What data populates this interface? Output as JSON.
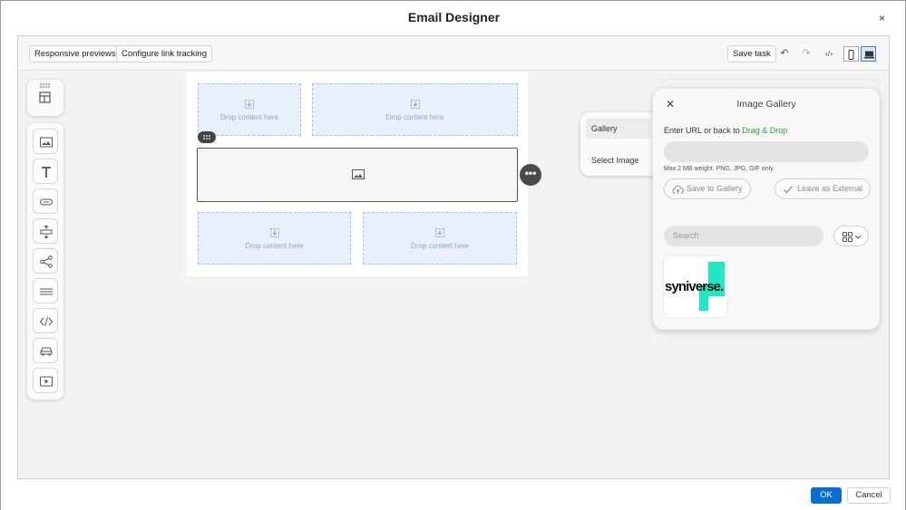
{
  "window": {
    "title": "Email Designer",
    "close_label": "×"
  },
  "toolbar": {
    "responsive_previews": "Responsive previews",
    "configure_link_tracking": "Configure link tracking",
    "save_task": "Save task",
    "undo_icon": "undo-icon",
    "redo_icon": "redo-icon",
    "code_icon": "code-icon",
    "mobile_view_icon": "mobile-icon",
    "desktop_view_icon": "desktop-icon",
    "active_view": "desktop"
  },
  "palette": {
    "items": [
      "grid-icon",
      "image-icon",
      "text-icon",
      "button-icon",
      "spacer-icon",
      "share-icon",
      "divider-icon",
      "html-icon",
      "car-icon",
      "video-icon"
    ]
  },
  "canvas": {
    "drop_label": "Drop content here",
    "drop_cells": [
      {
        "label": "Drop content here"
      },
      {
        "label": "Drop content here"
      },
      {
        "label": "Drop content here"
      },
      {
        "label": "Drop content here"
      }
    ]
  },
  "source_menu": {
    "items": [
      {
        "label": "Gallery",
        "active": true
      },
      {
        "label": "Select Image",
        "active": false
      }
    ]
  },
  "gallery": {
    "title": "Image Gallery",
    "close_label": "✕",
    "instruction": "Enter URL or back to ",
    "instruction_link": "Drag & Drop",
    "url_value": "",
    "note": "Max 2 MB weight. PNG, JPG, GIF only.",
    "save_to_gallery": "Save to Gallery",
    "leave_as_external": "Leave as External",
    "search_placeholder": "Search",
    "thumbnail_text": "syniverse."
  },
  "footer": {
    "ok": "OK",
    "cancel": "Cancel"
  },
  "colors": {
    "accent": "#0a6ed1",
    "link_green": "#2e9b3e",
    "drop_bg": "#e8f0fb",
    "brand_teal": "#1de9c4"
  }
}
